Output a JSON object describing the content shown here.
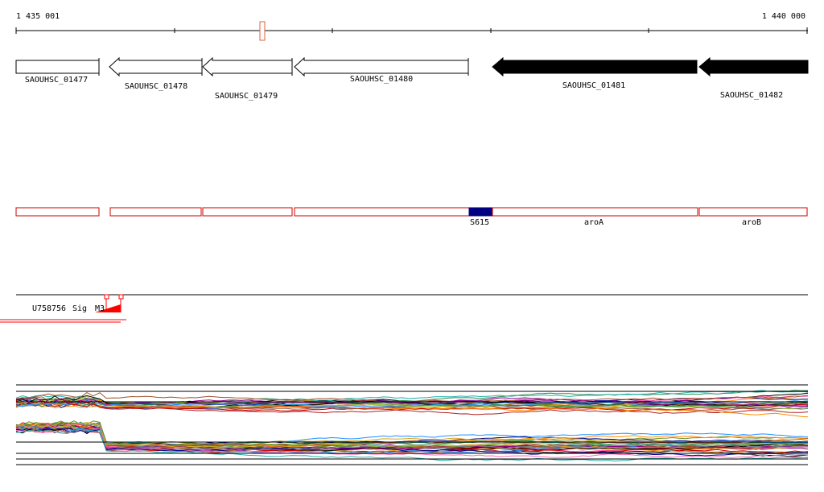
{
  "ruler": {
    "start_label": "1 435 001",
    "end_label": "1 440 000",
    "marker_color": "#e06040"
  },
  "genes": [
    {
      "name": "SAOUHSC_01477",
      "strand": "none",
      "filled": false
    },
    {
      "name": "SAOUHSC_01478",
      "strand": "reverse",
      "filled": false
    },
    {
      "name": "SAOUHSC_01479",
      "strand": "reverse",
      "filled": false
    },
    {
      "name": "SAOUHSC_01480",
      "strand": "reverse",
      "filled": false
    },
    {
      "name": "SAOUHSC_01481",
      "strand": "reverse",
      "filled": true
    },
    {
      "name": "SAOUHSC_01482",
      "strand": "reverse",
      "filled": true
    }
  ],
  "features": {
    "stroke_color": "#cc0000",
    "highlight_color": "#000080",
    "labels": {
      "s615": "S615",
      "aroA": "aroA",
      "aroB": "aroB"
    }
  },
  "reads_track": {
    "overlapping_label_1": "U75",
    "overlapping_label_2": "87",
    "overlapping_label_3": "56",
    "overlapping_label_4": "Sig",
    "overlapping_label_5": "M3",
    "marker_color": "#ff0000"
  },
  "expression_track": {
    "line_colors": [
      "#000000",
      "#cc0000",
      "#2e8b57",
      "#ff8c00",
      "#1e90ff",
      "#8b008b",
      "#a0522d",
      "#6b8e23",
      "#00008b",
      "#ff69b4",
      "#708090",
      "#daa520",
      "#20b2aa",
      "#b22222",
      "#9acd32"
    ]
  }
}
